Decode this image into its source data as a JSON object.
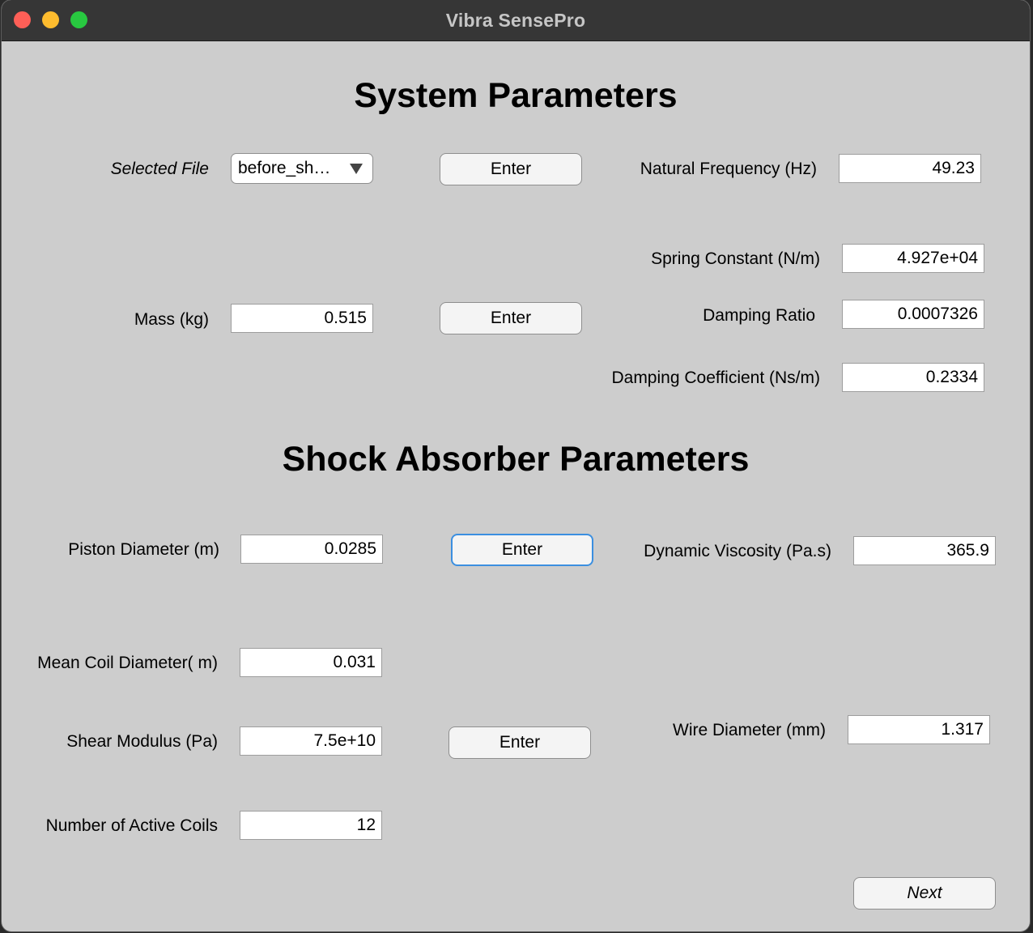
{
  "window": {
    "title": "Vibra SensePro"
  },
  "system": {
    "heading": "System Parameters",
    "selected_file_label": "Selected File",
    "selected_file_value": "before_sh…",
    "enter_file_label": "Enter",
    "natural_frequency_label": "Natural Frequency (Hz)",
    "natural_frequency_value": "49.23",
    "spring_constant_label": "Spring Constant (N/m)",
    "spring_constant_value": "4.927e+04",
    "mass_label": "Mass (kg)",
    "mass_value": "0.515",
    "enter_mass_label": "Enter",
    "damping_ratio_label": "Damping Ratio",
    "damping_ratio_value": "0.0007326",
    "damping_coefficient_label": "Damping Coefficient (Ns/m)",
    "damping_coefficient_value": "0.2334"
  },
  "shock": {
    "heading": "Shock Absorber Parameters",
    "piston_diameter_label": "Piston Diameter (m)",
    "piston_diameter_value": "0.0285",
    "enter_piston_label": "Enter",
    "dynamic_viscosity_label": "Dynamic Viscosity (Pa.s)",
    "dynamic_viscosity_value": "365.9",
    "mean_coil_diameter_label": "Mean Coil Diameter( m)",
    "mean_coil_diameter_value": "0.031",
    "shear_modulus_label": "Shear Modulus (Pa)",
    "shear_modulus_value": "7.5e+10",
    "enter_spring_label": "Enter",
    "wire_diameter_label": "Wire Diameter (mm)",
    "wire_diameter_value": "1.317",
    "active_coils_label": "Number of Active Coils",
    "active_coils_value": "12"
  },
  "footer": {
    "next_label": "Next"
  },
  "colors": {
    "window_bg": "#cdcdcd",
    "titlebar_bg": "#363636",
    "focus_ring": "#3b8fe0",
    "close": "#fe5f57",
    "minimize": "#febc2e",
    "zoom": "#28c840"
  }
}
